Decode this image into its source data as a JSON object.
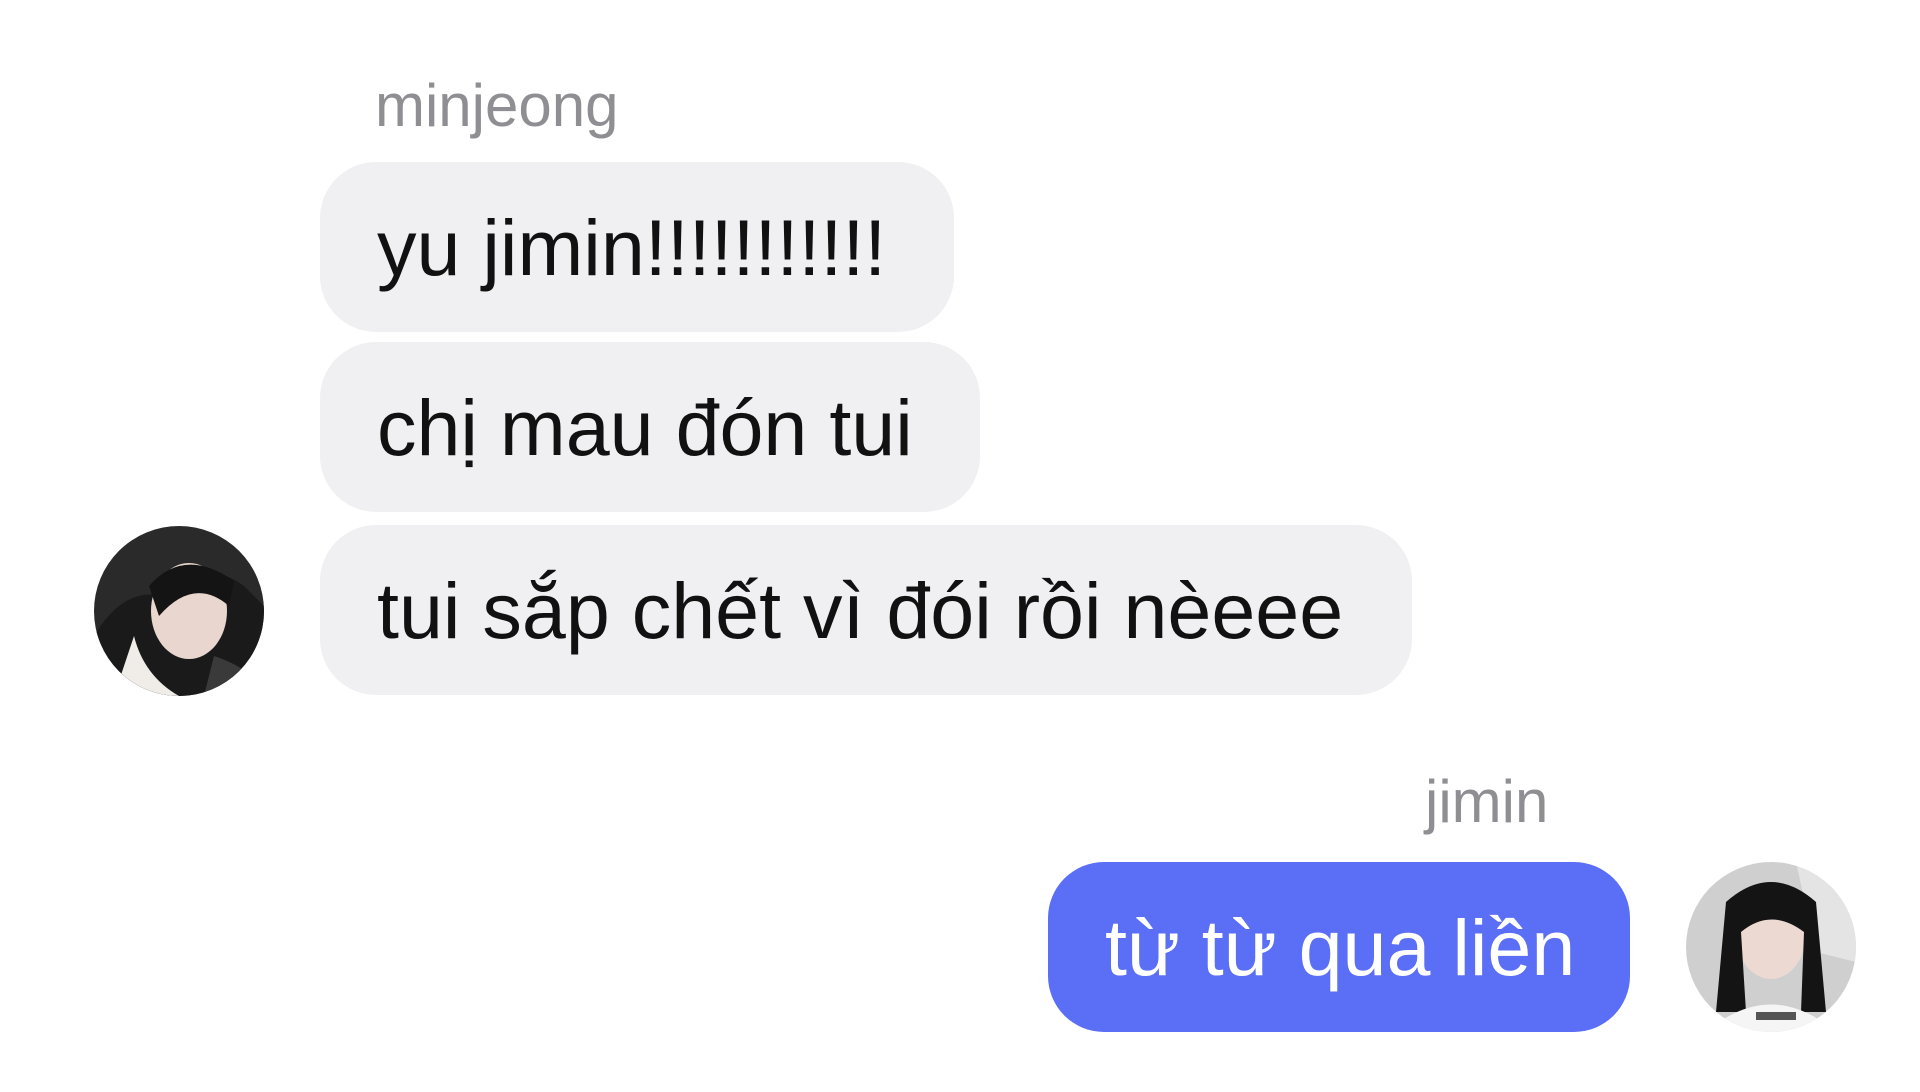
{
  "conversation": {
    "incoming": {
      "sender_name": "minjeong",
      "messages": [
        "yu jimin!!!!!!!!!!!",
        "chị mau đón tui",
        "tui sắp chết vì đói rồi nèeee"
      ]
    },
    "outgoing": {
      "sender_name": "jimin",
      "messages": [
        "từ từ qua liền"
      ]
    }
  },
  "colors": {
    "incoming_bubble": "#f0f0f2",
    "outgoing_bubble": "#5b6ef6",
    "sender_name": "#8e8e93",
    "background": "#ffffff"
  },
  "icons": {
    "incoming_avatar": "avatar-photo-icon",
    "outgoing_avatar": "avatar-photo-icon"
  }
}
